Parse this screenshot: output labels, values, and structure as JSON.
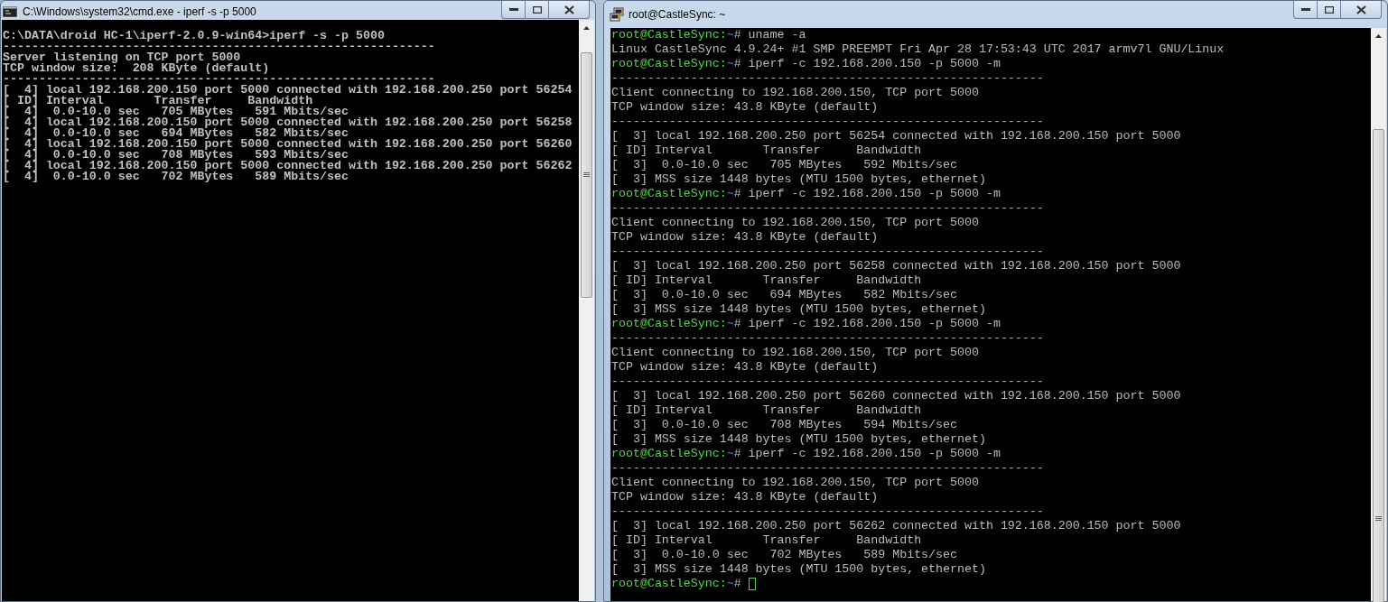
{
  "cmd_window": {
    "title": "C:\\Windows\\system32\\cmd.exe - iperf  -s -p 5000",
    "lines": [
      "C:\\DATA\\droid HC-1\\iperf-2.0.9-win64>iperf -s -p 5000",
      "------------------------------------------------------------",
      "Server listening on TCP port 5000",
      "TCP window size:  208 KByte (default)",
      "------------------------------------------------------------",
      "[  4] local 192.168.200.150 port 5000 connected with 192.168.200.250 port 56254",
      "[ ID] Interval       Transfer     Bandwidth",
      "[  4]  0.0-10.0 sec   705 MBytes   591 Mbits/sec",
      "[  4] local 192.168.200.150 port 5000 connected with 192.168.200.250 port 56258",
      "[  4]  0.0-10.0 sec   694 MBytes   582 Mbits/sec",
      "[  4] local 192.168.200.150 port 5000 connected with 192.168.200.250 port 56260",
      "[  4]  0.0-10.0 sec   708 MBytes   593 Mbits/sec",
      "[  4] local 192.168.200.150 port 5000 connected with 192.168.200.250 port 56262",
      "[  4]  0.0-10.0 sec   702 MBytes   589 Mbits/sec"
    ]
  },
  "putty_window": {
    "title": "root@CastleSync: ~",
    "lines": [
      {
        "kind": "prompt",
        "user_host": "root@CastleSync:",
        "path": "~",
        "symbol": "#",
        "command": "uname -a"
      },
      {
        "kind": "output",
        "text": "Linux CastleSync 4.9.24+ #1 SMP PREEMPT Fri Apr 28 17:53:43 UTC 2017 armv7l GNU/Linux"
      },
      {
        "kind": "prompt",
        "user_host": "root@CastleSync:",
        "path": "~",
        "symbol": "#",
        "command": "iperf -c 192.168.200.150 -p 5000 -m"
      },
      {
        "kind": "output",
        "text": "------------------------------------------------------------"
      },
      {
        "kind": "output",
        "text": "Client connecting to 192.168.200.150, TCP port 5000"
      },
      {
        "kind": "output",
        "text": "TCP window size: 43.8 KByte (default)"
      },
      {
        "kind": "output",
        "text": "------------------------------------------------------------"
      },
      {
        "kind": "output",
        "text": "[  3] local 192.168.200.250 port 56254 connected with 192.168.200.150 port 5000"
      },
      {
        "kind": "output",
        "text": "[ ID] Interval       Transfer     Bandwidth"
      },
      {
        "kind": "output",
        "text": "[  3]  0.0-10.0 sec   705 MBytes   592 Mbits/sec"
      },
      {
        "kind": "output",
        "text": "[  3] MSS size 1448 bytes (MTU 1500 bytes, ethernet)"
      },
      {
        "kind": "prompt",
        "user_host": "root@CastleSync:",
        "path": "~",
        "symbol": "#",
        "command": "iperf -c 192.168.200.150 -p 5000 -m"
      },
      {
        "kind": "output",
        "text": "------------------------------------------------------------"
      },
      {
        "kind": "output",
        "text": "Client connecting to 192.168.200.150, TCP port 5000"
      },
      {
        "kind": "output",
        "text": "TCP window size: 43.8 KByte (default)"
      },
      {
        "kind": "output",
        "text": "------------------------------------------------------------"
      },
      {
        "kind": "output",
        "text": "[  3] local 192.168.200.250 port 56258 connected with 192.168.200.150 port 5000"
      },
      {
        "kind": "output",
        "text": "[ ID] Interval       Transfer     Bandwidth"
      },
      {
        "kind": "output",
        "text": "[  3]  0.0-10.0 sec   694 MBytes   582 Mbits/sec"
      },
      {
        "kind": "output",
        "text": "[  3] MSS size 1448 bytes (MTU 1500 bytes, ethernet)"
      },
      {
        "kind": "prompt",
        "user_host": "root@CastleSync:",
        "path": "~",
        "symbol": "#",
        "command": "iperf -c 192.168.200.150 -p 5000 -m"
      },
      {
        "kind": "output",
        "text": "------------------------------------------------------------"
      },
      {
        "kind": "output",
        "text": "Client connecting to 192.168.200.150, TCP port 5000"
      },
      {
        "kind": "output",
        "text": "TCP window size: 43.8 KByte (default)"
      },
      {
        "kind": "output",
        "text": "------------------------------------------------------------"
      },
      {
        "kind": "output",
        "text": "[  3] local 192.168.200.250 port 56260 connected with 192.168.200.150 port 5000"
      },
      {
        "kind": "output",
        "text": "[ ID] Interval       Transfer     Bandwidth"
      },
      {
        "kind": "output",
        "text": "[  3]  0.0-10.0 sec   708 MBytes   594 Mbits/sec"
      },
      {
        "kind": "output",
        "text": "[  3] MSS size 1448 bytes (MTU 1500 bytes, ethernet)"
      },
      {
        "kind": "prompt",
        "user_host": "root@CastleSync:",
        "path": "~",
        "symbol": "#",
        "command": "iperf -c 192.168.200.150 -p 5000 -m"
      },
      {
        "kind": "output",
        "text": "------------------------------------------------------------"
      },
      {
        "kind": "output",
        "text": "Client connecting to 192.168.200.150, TCP port 5000"
      },
      {
        "kind": "output",
        "text": "TCP window size: 43.8 KByte (default)"
      },
      {
        "kind": "output",
        "text": "------------------------------------------------------------"
      },
      {
        "kind": "output",
        "text": "[  3] local 192.168.200.250 port 56262 connected with 192.168.200.150 port 5000"
      },
      {
        "kind": "output",
        "text": "[ ID] Interval       Transfer     Bandwidth"
      },
      {
        "kind": "output",
        "text": "[  3]  0.0-10.0 sec   702 MBytes   589 Mbits/sec"
      },
      {
        "kind": "output",
        "text": "[  3] MSS size 1448 bytes (MTU 1500 bytes, ethernet)"
      },
      {
        "kind": "prompt",
        "user_host": "root@CastleSync:",
        "path": "~",
        "symbol": "#",
        "cursor": true
      }
    ]
  }
}
